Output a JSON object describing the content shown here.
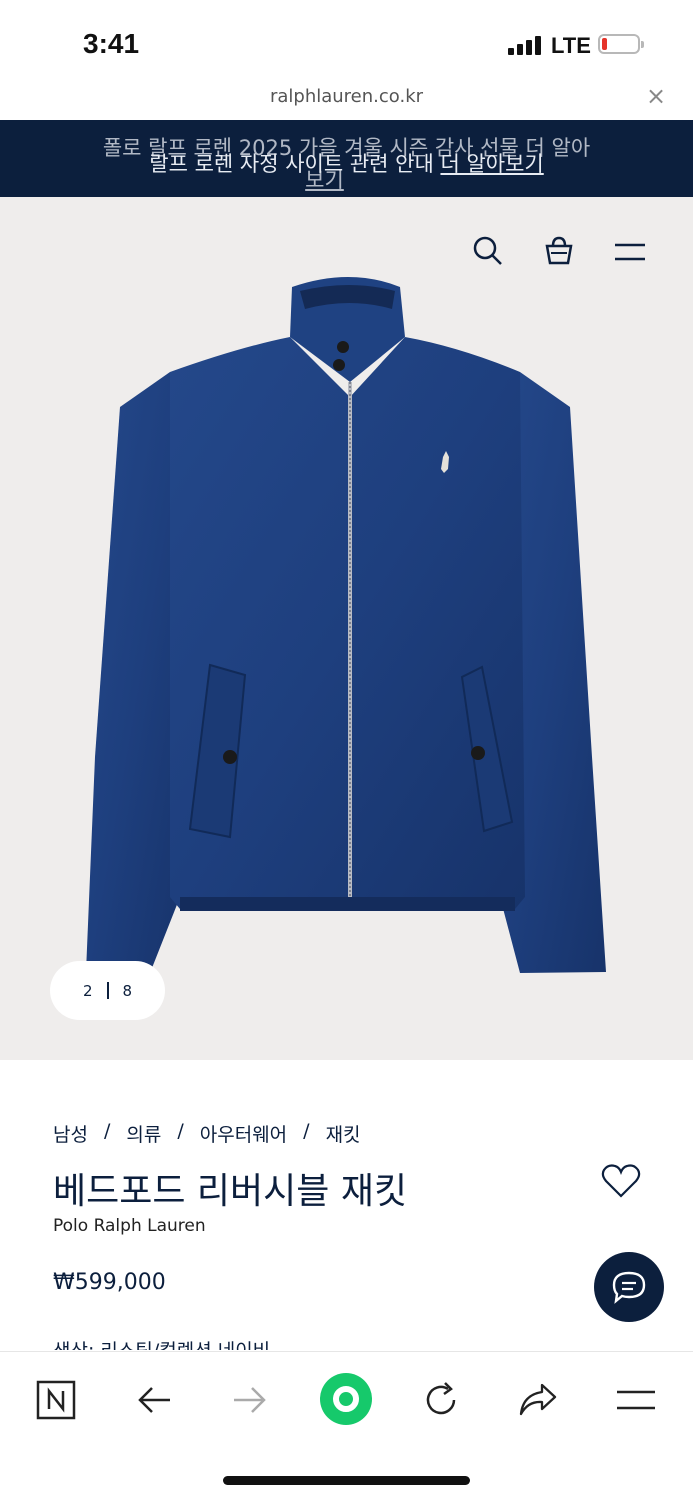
{
  "status": {
    "time": "3:41",
    "network": "LTE"
  },
  "browser": {
    "url": "ralphlauren.co.kr",
    "close_symbol": "×"
  },
  "promo": {
    "line_a": "폴로 랄프 로렌 2025 가을 겨울 시즌 감사 선물 더 알아",
    "line_b_text": "랄프 로렌 자정 사이트 관련 안내 ",
    "line_b_link": "더 알아보기",
    "line_c": "보기"
  },
  "gallery": {
    "current": "2",
    "total": "8"
  },
  "breadcrumb": [
    "남성",
    "의류",
    "아우터웨어",
    "재킷"
  ],
  "product": {
    "title": "베드포드 리버시블 재킷",
    "brand": "Polo Ralph Lauren",
    "price": "₩599,000",
    "color_label": "색상: 리스틱/컬렉션 네이비"
  },
  "colors": {
    "navy": "#0c1f3d",
    "jacket": "#1e3f7e",
    "hero_bg": "#efedec",
    "accent_green": "#16c96b"
  },
  "icons": [
    "search-icon",
    "bag-icon",
    "menu-icon",
    "heart-icon",
    "chat-icon",
    "naver-icon",
    "back-icon",
    "forward-icon",
    "home-icon",
    "reload-icon",
    "share-icon",
    "more-menu-icon"
  ]
}
